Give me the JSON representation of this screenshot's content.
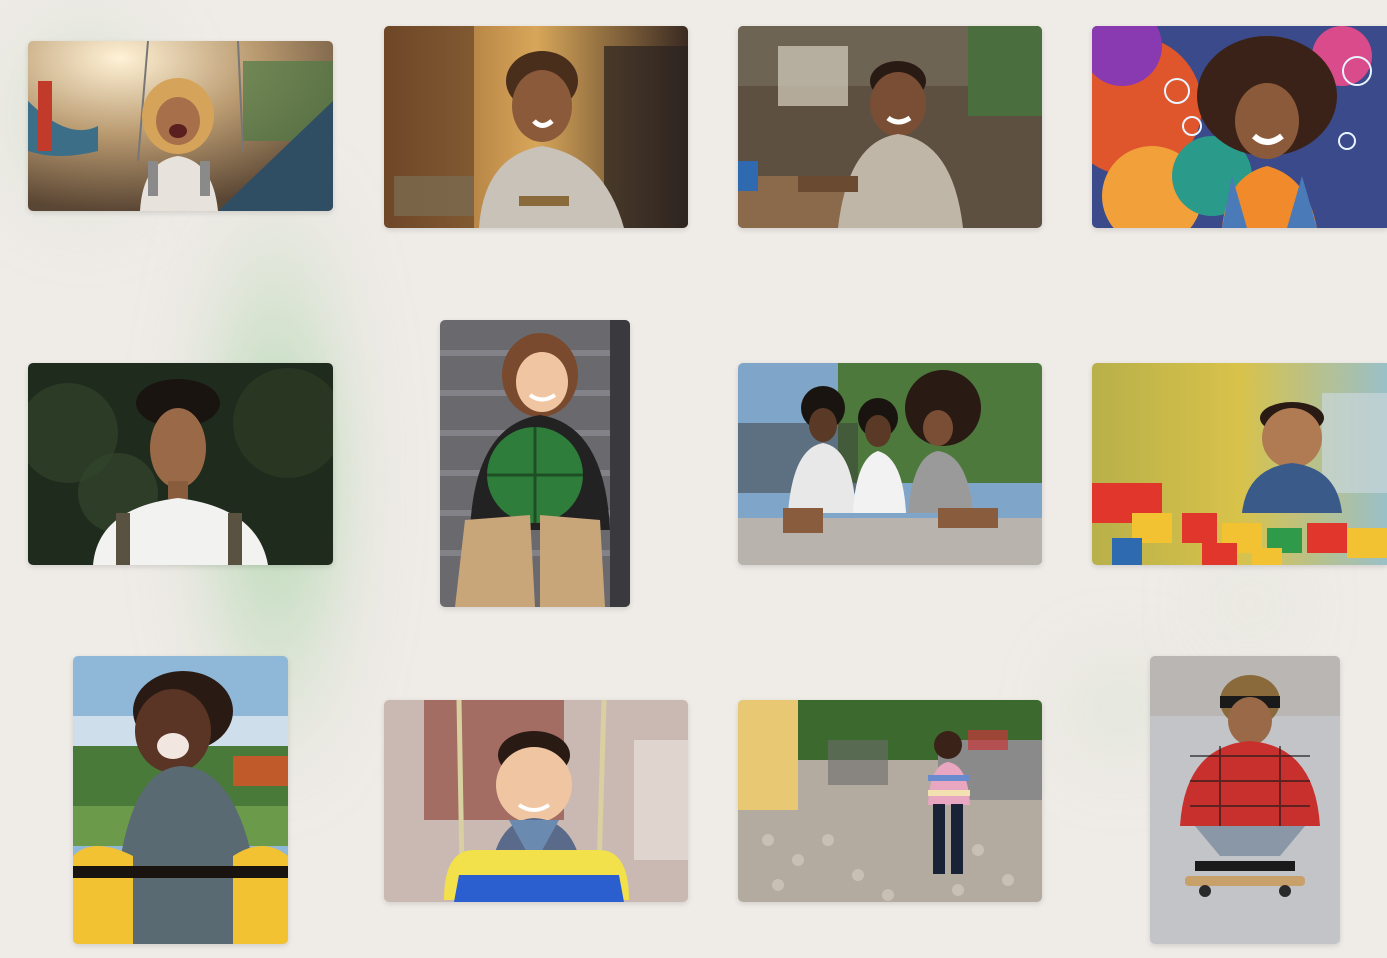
{
  "page": {
    "background_color": "#efebe7",
    "accent_glow_color": "#8fd08f"
  },
  "gallery": {
    "photos": [
      {
        "id": "photo-1",
        "depicts": "laughing-toddler-on-swing-icon",
        "palette": [
          "#f1d9a8",
          "#8c6a4a",
          "#2f4e63"
        ]
      },
      {
        "id": "photo-2",
        "depicts": "smiling-boy-in-market-street-icon",
        "palette": [
          "#b07a3c",
          "#3a2a22",
          "#c9c2b8"
        ]
      },
      {
        "id": "photo-3",
        "depicts": "smiling-boy-by-shacks-icon",
        "palette": [
          "#6b5a45",
          "#c8c0b0",
          "#3e5a3a"
        ]
      },
      {
        "id": "photo-4",
        "depicts": "girl-with-colorful-bubbles-icon",
        "palette": [
          "#d94b2b",
          "#3b7fc4",
          "#f2a13a"
        ]
      },
      {
        "id": "photo-5",
        "depicts": "young-man-in-forest-icon",
        "palette": [
          "#1f2b1c",
          "#f2f2f0",
          "#5b3a2a"
        ]
      },
      {
        "id": "photo-6",
        "depicts": "girl-holding-green-ball-on-stairs-icon",
        "palette": [
          "#7a7a7a",
          "#2e7d3a",
          "#c9a57a"
        ]
      },
      {
        "id": "photo-7",
        "depicts": "three-teens-sitting-on-wall-icon",
        "palette": [
          "#7fa6c9",
          "#4d7a3c",
          "#b8b4ad"
        ]
      },
      {
        "id": "photo-8",
        "depicts": "toddler-with-building-blocks-icon",
        "palette": [
          "#d8c24a",
          "#e0362c",
          "#6f9fc0"
        ]
      },
      {
        "id": "photo-9",
        "depicts": "laughing-child-on-playground-ride-icon",
        "palette": [
          "#8fb7d8",
          "#f2c232",
          "#3a2e2a"
        ]
      },
      {
        "id": "photo-10",
        "depicts": "baby-in-blue-swing-icon",
        "palette": [
          "#c9b9b2",
          "#2b5fd0",
          "#f2e14a"
        ]
      },
      {
        "id": "photo-11",
        "depicts": "toddler-walking-on-cobblestones-icon",
        "palette": [
          "#e8c872",
          "#b3aaa0",
          "#3c6a2e"
        ]
      },
      {
        "id": "photo-12",
        "depicts": "kid-on-skateboard-icon",
        "palette": [
          "#c2c4c8",
          "#c8302e",
          "#8a6a3a"
        ]
      }
    ]
  }
}
